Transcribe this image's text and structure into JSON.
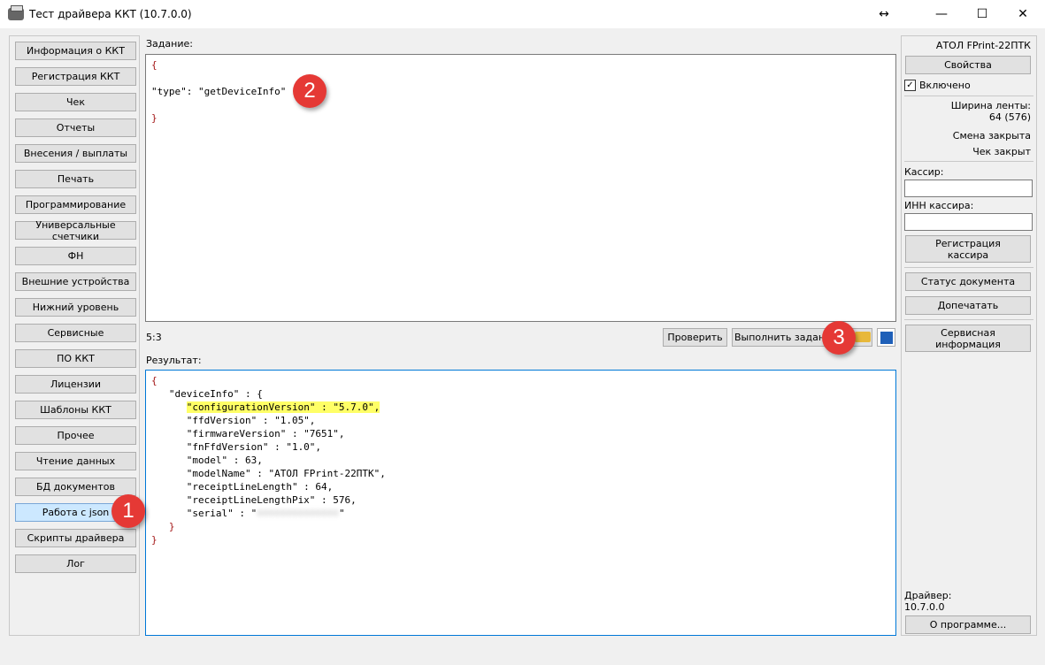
{
  "window": {
    "title": "Тест драйвера ККТ (10.7.0.0)",
    "minimize": "—",
    "maximize": "☐",
    "close": "✕",
    "resize": "↔"
  },
  "sidebar": {
    "items": [
      {
        "label": "Информация о ККТ"
      },
      {
        "label": "Регистрация ККТ"
      },
      {
        "label": "Чек"
      },
      {
        "label": "Отчеты"
      },
      {
        "label": "Внесения / выплаты"
      },
      {
        "label": "Печать"
      },
      {
        "label": "Программирование"
      },
      {
        "label": "Универсальные счетчики"
      },
      {
        "label": "ФН"
      },
      {
        "label": "Внешние устройства"
      },
      {
        "label": "Нижний уровень"
      },
      {
        "label": "Сервисные"
      },
      {
        "label": "ПО ККТ"
      },
      {
        "label": "Лицензии"
      },
      {
        "label": "Шаблоны ККТ"
      },
      {
        "label": "Прочее"
      },
      {
        "label": "Чтение данных"
      },
      {
        "label": "БД документов"
      },
      {
        "label": "Работа с json",
        "selected": true
      },
      {
        "label": "Скрипты драйвера"
      },
      {
        "label": "Лог"
      }
    ]
  },
  "task": {
    "label": "Задание:",
    "open_brace": "{",
    "key": "\"type\"",
    "colon": ": ",
    "value": "\"getDeviceInfo\"",
    "close_brace": "}"
  },
  "cursor_pos": "5:3",
  "buttons": {
    "check": "Проверить",
    "execute": "Выполнить задание"
  },
  "result": {
    "label": "Результат:",
    "lines": [
      "{",
      "   \"deviceInfo\" : {",
      "      \"configurationVersion\" : \"5.7.0\",",
      "      \"ffdVersion\" : \"1.05\",",
      "      \"firmwareVersion\" : \"7651\",",
      "      \"fnFfdVersion\" : \"1.0\",",
      "      \"model\" : 63,",
      "      \"modelName\" : \"АТОЛ FPrint-22ПТК\",",
      "      \"receiptLineLength\" : 64,",
      "      \"receiptLineLengthPix\" : 576,",
      "      \"serial\" : \"",
      "   }",
      "}"
    ],
    "serial_blurred": "00000000000000",
    "highlight_color": "#ffff66"
  },
  "right": {
    "device": "АТОЛ FPrint-22ПТК",
    "properties": "Свойства",
    "enabled_label": "Включено",
    "enabled": true,
    "tape_width_label": "Ширина ленты:",
    "tape_width": "64 (576)",
    "shift": "Смена закрыта",
    "receipt": "Чек закрыт",
    "cashier_label": "Кассир:",
    "cashier_value": "",
    "inn_label": "ИНН кассира:",
    "inn_value": "",
    "register_cashier": "Регистрация кассира",
    "doc_status": "Статус документа",
    "reprint": "Допечатать",
    "service_info": "Сервисная информация",
    "driver_label": "Драйвер:",
    "driver_version": "10.7.0.0",
    "about": "О программе..."
  },
  "badges": [
    "1",
    "2",
    "3"
  ],
  "colors": {
    "accent": "#0078d7",
    "selected": "#cce8ff",
    "badge": "#e53935"
  }
}
